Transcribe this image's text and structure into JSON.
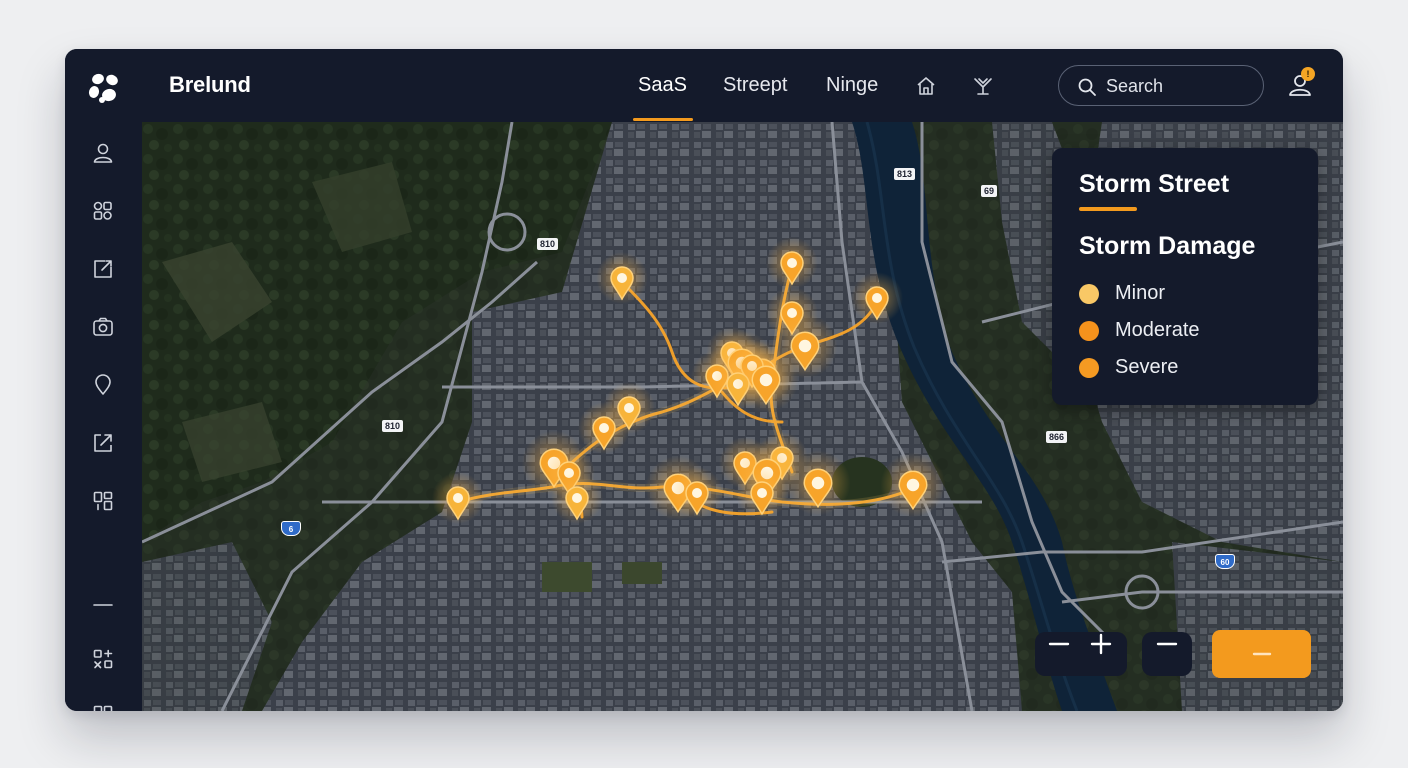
{
  "app": {
    "brand": "Brelund"
  },
  "nav": {
    "items": [
      {
        "label": "SaaS",
        "active": true
      },
      {
        "label": "Streept",
        "active": false
      },
      {
        "label": "Ninge",
        "active": false
      }
    ],
    "icons": [
      "home-outline-icon",
      "route-branch-icon"
    ]
  },
  "search": {
    "placeholder": "Search"
  },
  "user": {
    "notification_badge": "!"
  },
  "sidebar": {
    "icons": [
      "user-icon",
      "layers-icon",
      "edit-share-icon",
      "camera-icon",
      "location-pin-icon",
      "export-icon",
      "grid-panels-icon",
      "divider-icon",
      "widgets-icon",
      "apps-grid-icon"
    ]
  },
  "map": {
    "road_labels": [
      "810",
      "813",
      "69",
      "810",
      "866"
    ],
    "route_shields": [
      "6",
      "60"
    ],
    "damage_reports": [
      {
        "severity": "Minor"
      },
      {
        "severity": "Moderate"
      },
      {
        "severity": "Severe"
      }
    ]
  },
  "legend": {
    "title": "Storm Street",
    "subtitle": "Storm Damage",
    "items": [
      {
        "label": "Minor",
        "color": "#f9c866"
      },
      {
        "label": "Moderate",
        "color": "#f5921c"
      },
      {
        "label": "Severe",
        "color": "#f59a22"
      }
    ]
  },
  "colors": {
    "accent": "#f39a1e",
    "panel": "#141a2b",
    "pin": "#f7a42a"
  }
}
